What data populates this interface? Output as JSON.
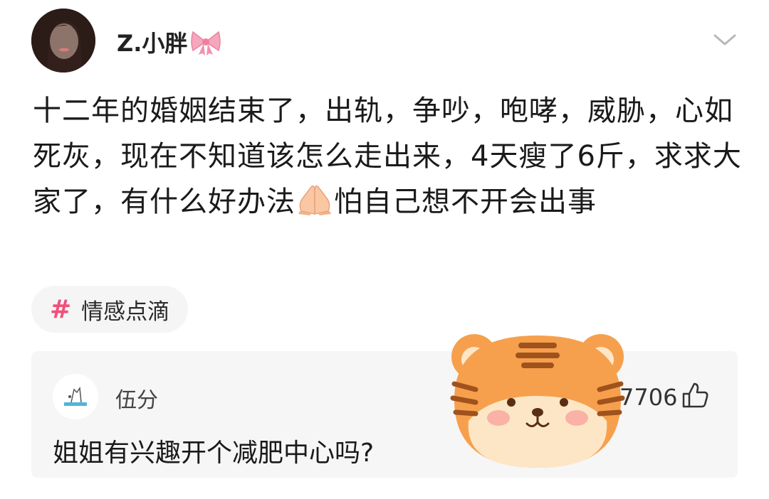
{
  "post": {
    "username": "Z.小胖",
    "text_parts": [
      "十二年的婚姻结束了，出轨，争吵，咆哮，威胁，心如死灰，现在不知道该怎么走出来，4天瘦了6斤，求求大家了，有什么好办法",
      "怕自己想不开会出事"
    ]
  },
  "topic": {
    "label": "情感点滴"
  },
  "comment": {
    "username": "伍分",
    "text": "姐姐有兴趣开个减肥中心吗?",
    "likes": "7706"
  },
  "icons": {
    "bow": "pink-bow-icon",
    "pray": "praying-hands-emoji",
    "chevron": "chevron-down-icon",
    "like": "thumbs-up-icon",
    "sticker": "tiger-face-sticker"
  },
  "colors": {
    "topic_hash": "#f0507a",
    "card_bg": "#f6f6f6",
    "tiger_orange": "#f6a04d"
  }
}
